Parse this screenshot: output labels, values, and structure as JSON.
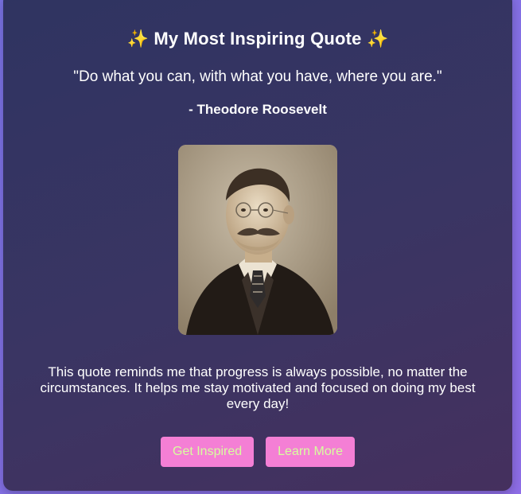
{
  "card": {
    "sparkle_left": "✨",
    "title": "My Most Inspiring Quote",
    "sparkle_right": "✨",
    "quote": "\"Do what you can, with what you have, where you are.\"",
    "author": "- Theodore Roosevelt",
    "portrait_subject": "Theodore Roosevelt portrait (sepia photograph)",
    "reflection": "This quote reminds me that progress is always possible, no matter the circumstances. It helps me stay motivated and focused on doing my best every day!"
  },
  "buttons": {
    "inspire_label": "Get Inspired",
    "learn_label": "Learn More"
  },
  "colors": {
    "background_accent": "#8b72e8",
    "card_background": "#35345f",
    "button_background": "#f47fd5",
    "button_text": "#d7ff9e",
    "sparkle": "#f7d14a"
  }
}
